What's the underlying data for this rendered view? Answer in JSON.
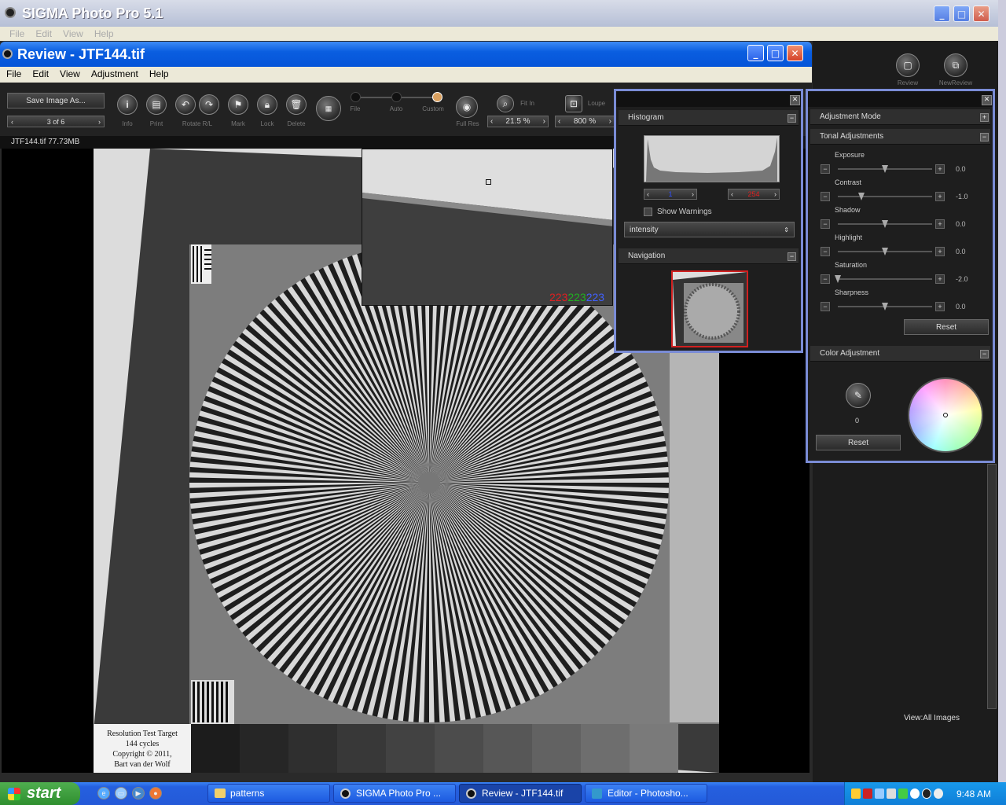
{
  "sigma_window": {
    "title": "SIGMA Photo Pro 5.1",
    "menu": [
      "File",
      "Edit",
      "View",
      "Help"
    ]
  },
  "review_window": {
    "title": "Review - JTF144.tif",
    "menu": [
      "File",
      "Edit",
      "View",
      "Adjustment",
      "Help"
    ],
    "save_label": "Save Image As...",
    "page_counter": "3 of 6",
    "file_info": "JTF144.tif 77.73MB",
    "toolbar_labels": [
      "Info",
      "Print",
      "Rotate R/L",
      "Mark",
      "Lock",
      "Delete"
    ],
    "mode_labels": [
      "File",
      "Auto",
      "Custom"
    ],
    "fullres_label": "Full Res",
    "fitin_label": "Fit In",
    "fitin_zoom": "21.5 %",
    "loupe_label": "Loupe",
    "loupe_zoom": "800 %",
    "readout": {
      "r": "223",
      "g": "223",
      "b": "223"
    },
    "target_text": [
      "Resolution Test Target",
      "144 cycles",
      "Copyright © 2011,",
      "Bart van der Wolf"
    ]
  },
  "right_bar": {
    "review": "Review",
    "new_review": "NewReview",
    "view_all": "View:All Images"
  },
  "histogram_panel": {
    "title": "Histogram",
    "low": "1",
    "high": "254",
    "show_warnings": "Show Warnings",
    "channel": "intensity",
    "navigation_title": "Navigation"
  },
  "adjust_panel": {
    "mode_title": "Adjustment Mode",
    "tonal_title": "Tonal Adjustments",
    "sliders": [
      {
        "label": "Exposure",
        "value": "0.0",
        "pos": 0.5
      },
      {
        "label": "Contrast",
        "value": "-1.0",
        "pos": 0.25
      },
      {
        "label": "Shadow",
        "value": "0.0",
        "pos": 0.5
      },
      {
        "label": "Highlight",
        "value": "0.0",
        "pos": 0.5
      },
      {
        "label": "Saturation",
        "value": "-2.0",
        "pos": 0.0
      },
      {
        "label": "Sharpness",
        "value": "0.0",
        "pos": 0.5
      }
    ],
    "reset": "Reset",
    "color_title": "Color Adjustment",
    "color_value": "0",
    "color_reset": "Reset"
  },
  "taskbar": {
    "start": "start",
    "items": [
      "patterns",
      "SIGMA Photo Pro ...",
      "Review - JTF144.tif",
      "Editor - Photosho..."
    ],
    "clock": "9:48 AM"
  },
  "colors": {
    "accent_red": "#e02020",
    "accent_green": "#20b020",
    "accent_blue": "#4060ff",
    "panel_border": "#7a8cd6"
  }
}
